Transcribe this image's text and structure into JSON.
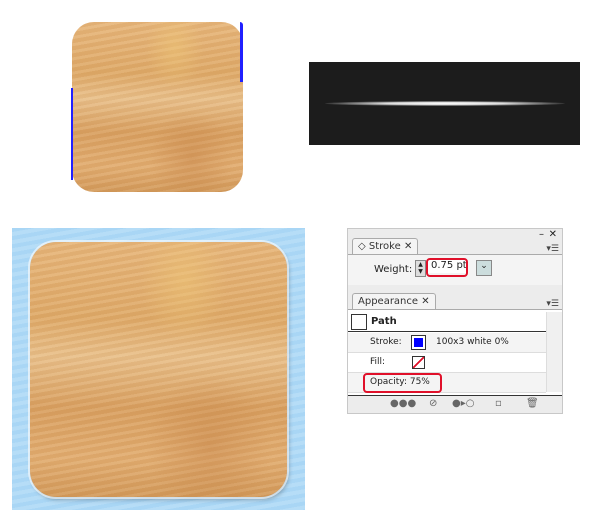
{
  "stroke_panel": {
    "tab": "Stroke",
    "weight_label": "Weight:",
    "weight_value": "0.75 pt"
  },
  "appearance_panel": {
    "tab": "Appearance",
    "path_label": "Path",
    "stroke_label": "Stroke:",
    "stroke_value": "100x3 white 0%",
    "fill_label": "Fill:",
    "opacity_label": "Opacity: 75%"
  },
  "colors": {
    "stroke_swatch": "#0000ff",
    "highlight": "#e0102a",
    "background_blue": "#a9d6f5"
  },
  "icons": [
    "close-icon",
    "minimize-icon",
    "panel-menu-icon",
    "stepper-icon",
    "dropdown-icon",
    "new-art-icon",
    "clear-icon",
    "reduce-basic-icon",
    "duplicate-icon",
    "trash-icon"
  ]
}
